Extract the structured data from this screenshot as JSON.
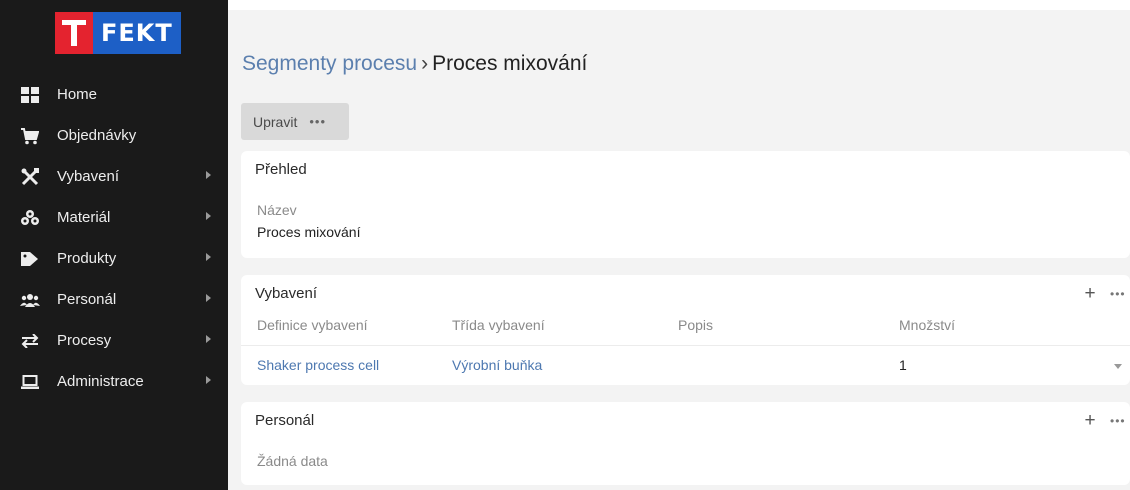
{
  "logo": {
    "text": "FEKT"
  },
  "nav": {
    "items": [
      {
        "label": "Home"
      },
      {
        "label": "Objednávky"
      },
      {
        "label": "Vybavení"
      },
      {
        "label": "Materiál"
      },
      {
        "label": "Produkty"
      },
      {
        "label": "Personál"
      },
      {
        "label": "Procesy"
      },
      {
        "label": "Administrace"
      }
    ]
  },
  "breadcrumb": {
    "parent": "Segmenty procesu",
    "separator": "›",
    "current": "Proces mixování"
  },
  "toolbar": {
    "edit_label": "Upravit",
    "more_label": "•••"
  },
  "overview": {
    "title": "Přehled",
    "name_label": "Název",
    "name_value": "Proces mixování"
  },
  "equipment": {
    "title": "Vybavení",
    "add_label": "+",
    "more_label": "•••",
    "columns": [
      "Definice vybavení",
      "Třída vybavení",
      "Popis",
      "Množství"
    ],
    "rows": [
      {
        "definition": "Shaker process cell",
        "class": "Výrobní buňka",
        "description": "",
        "quantity": "1"
      }
    ]
  },
  "personnel": {
    "title": "Personál",
    "add_label": "+",
    "more_label": "•••",
    "empty_text": "Žádná data"
  },
  "colors": {
    "sidebar_bg": "#1a1a1a",
    "logo_blue": "#1d5fc6",
    "logo_red": "#e4232f",
    "link": "#4d78b0",
    "main_bg": "#f3f3f3"
  }
}
